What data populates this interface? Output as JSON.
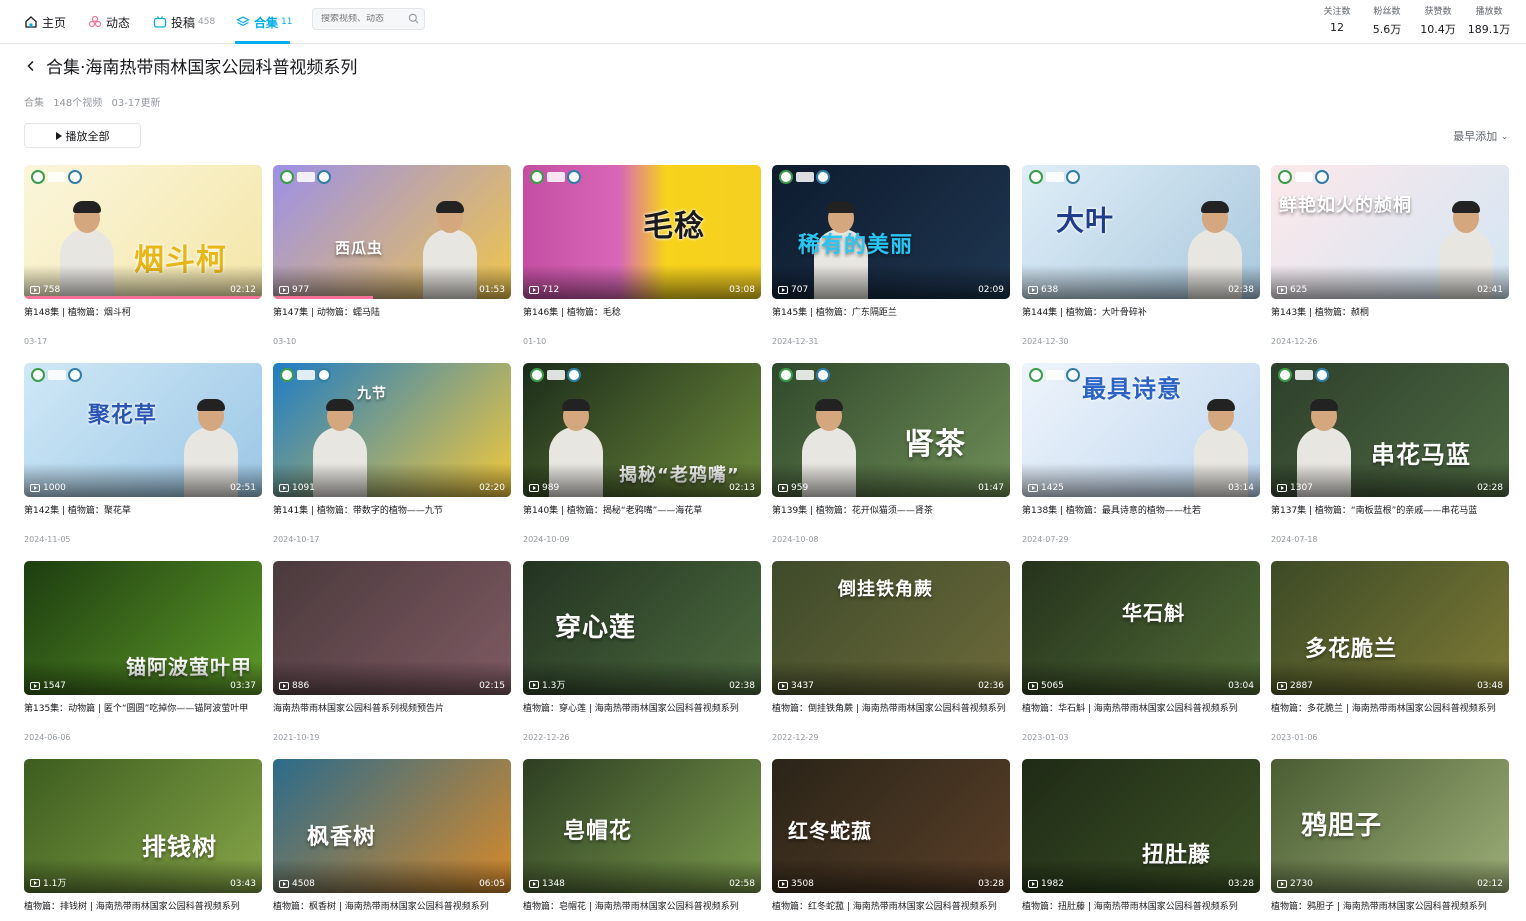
{
  "nav": {
    "home": "主页",
    "dynamic": "动态",
    "uploads": "投稿",
    "uploads_count": "458",
    "collections": "合集",
    "collections_count": "11",
    "search_placeholder": "搜索视频、动态"
  },
  "stats": [
    {
      "label": "关注数",
      "value": "12"
    },
    {
      "label": "粉丝数",
      "value": "5.6万"
    },
    {
      "label": "获赞数",
      "value": "10.4万"
    },
    {
      "label": "播放数",
      "value": "189.1万"
    }
  ],
  "collection": {
    "title": "合集·海南热带雨林国家公园科普视频系列",
    "type": "合集",
    "video_count": "148个视频",
    "updated": "03-17更新",
    "play_all": "播放全部",
    "sort": "最早添加"
  },
  "colors": {
    "accent": "#00aeec",
    "progress": "#fb7299"
  },
  "videos": [
    {
      "views": "758",
      "duration": "02:12",
      "title": "第148集 | 植物篇：烟斗柯",
      "date": "03-17",
      "overlay": "烟斗柯",
      "bg": "linear-gradient(135deg,#fbf6dc,#f4e6a8)",
      "ink": "#e8b617",
      "person": true,
      "watched": 1
    },
    {
      "views": "977",
      "duration": "01:53",
      "title": "第147集 | 动物篇：蠕马陆",
      "date": "03-10",
      "overlay": "西瓜虫",
      "bg": "linear-gradient(135deg,#9b8fe8,#f0c64a)",
      "ink": "#ffffff",
      "person": true,
      "watched": 0.42
    },
    {
      "views": "712",
      "duration": "03:08",
      "title": "第146集 | 植物篇：毛稔",
      "date": "01-10",
      "overlay": "毛稔",
      "bg": "linear-gradient(90deg,#c44fa2 0%,#d866b7 40%,#f7d31c 60%,#f5cf20 100%)",
      "ink": "#1a1a1a",
      "person": false,
      "watched": 0
    },
    {
      "views": "707",
      "duration": "02:09",
      "title": "第145集 | 植物篇：广东隔距兰",
      "date": "2024-12-31",
      "overlay": "稀有的美丽",
      "bg": "linear-gradient(135deg,#0d1b2e,#1f3650)",
      "ink": "#29c6f4",
      "person": true,
      "watched": 0
    },
    {
      "views": "638",
      "duration": "02:38",
      "title": "第144集 | 植物篇：大叶骨碎补",
      "date": "2024-12-30",
      "overlay": "大叶",
      "bg": "linear-gradient(135deg,#dfeef8,#a9c8dd)",
      "ink": "#1f3d8a",
      "person": true,
      "watched": 0
    },
    {
      "views": "625",
      "duration": "02:41",
      "title": "第143集 | 植物篇：赪桐",
      "date": "2024-12-26",
      "overlay": "鲜艳如火的赪桐",
      "bg": "linear-gradient(135deg,#fde8ea,#d2e6f4)",
      "ink": "#ffffff",
      "person": true,
      "watched": 0
    },
    {
      "views": "1000",
      "duration": "02:51",
      "title": "第142集 | 植物篇：聚花草",
      "date": "2024-11-05",
      "overlay": "聚花草",
      "bg": "linear-gradient(135deg,#cfe8f6,#9cc7e6)",
      "ink": "#2a55b3",
      "person": true,
      "watched": 0
    },
    {
      "views": "1091",
      "duration": "02:20",
      "title": "第141集 | 植物篇：带数字的植物——九节",
      "date": "2024-10-17",
      "overlay": "九节",
      "bg": "linear-gradient(135deg,#1d7cc6,#f3c83b)",
      "ink": "#ffffff",
      "person": true,
      "watched": 0
    },
    {
      "views": "989",
      "duration": "02:13",
      "title": "第140集 | 植物篇：揭秘“老鸦嘴”——海花草",
      "date": "2024-10-09",
      "overlay": "揭秘“老鸦嘴”",
      "bg": "linear-gradient(135deg,#1b2c1a,#6d8a3b)",
      "ink": "#ffffff",
      "person": true,
      "watched": 0
    },
    {
      "views": "959",
      "duration": "01:47",
      "title": "第139集 | 植物篇：花开似猫须——肾茶",
      "date": "2024-10-08",
      "overlay": "肾茶",
      "bg": "linear-gradient(135deg,#30482b,#6f8f58)",
      "ink": "#ffffff",
      "person": true,
      "watched": 0
    },
    {
      "views": "1425",
      "duration": "03:14",
      "title": "第138集 | 植物篇：最具诗意的植物——杜若",
      "date": "2024-07-29",
      "overlay": "最具诗意",
      "bg": "linear-gradient(135deg,#eef4fb,#bfd7ef)",
      "ink": "#2b63c6",
      "person": true,
      "watched": 0
    },
    {
      "views": "1307",
      "duration": "02:28",
      "title": "第137集 | 植物篇：“南板蓝根”的亲戚——串花马蓝",
      "date": "2024-07-18",
      "overlay": "串花马蓝",
      "bg": "linear-gradient(135deg,#2d3f2b,#4f6b43)",
      "ink": "#ffffff",
      "person": true,
      "watched": 0
    },
    {
      "views": "1547",
      "duration": "03:37",
      "title": "第135集：动物篇 | 匿个“圆圆”吃掉你——锚阿波萤叶甲",
      "date": "2024-06-06",
      "overlay": "锚阿波萤叶甲",
      "bg": "linear-gradient(135deg,#1d3d10,#5d9a28)",
      "ink": "#ffffff",
      "person": false,
      "watched": 0
    },
    {
      "views": "886",
      "duration": "02:15",
      "title": "海南热带雨林国家公园科普系列视频预告片",
      "date": "2021-10-19",
      "overlay": "",
      "bg": "linear-gradient(135deg,#4a3a3c,#7f5a63)",
      "ink": "#ffffff",
      "person": false,
      "watched": 0
    },
    {
      "views": "1.3万",
      "duration": "02:38",
      "title": "植物篇：穿心莲 | 海南热带雨林国家公园科普视频系列",
      "date": "2022-12-26",
      "overlay": "穿心莲",
      "bg": "linear-gradient(135deg,#233321,#4d6b3f)",
      "ink": "#ffffff",
      "person": false,
      "watched": 0
    },
    {
      "views": "3437",
      "duration": "02:36",
      "title": "植物篇：倒挂铁角蕨 | 海南热带雨林国家公园科普视频系列",
      "date": "2022-12-29",
      "overlay": "倒挂铁角蕨",
      "bg": "linear-gradient(135deg,#3e4a2a,#6c6a3a)",
      "ink": "#ffffff",
      "person": false,
      "watched": 0
    },
    {
      "views": "5065",
      "duration": "03:04",
      "title": "植物篇：华石斛 | 海南热带雨林国家公园科普视频系列",
      "date": "2023-01-03",
      "overlay": "华石斛",
      "bg": "linear-gradient(135deg,#25331c,#506a36)",
      "ink": "#ffffff",
      "person": false,
      "watched": 0
    },
    {
      "views": "2887",
      "duration": "03:48",
      "title": "植物篇：多花脆兰 | 海南热带雨林国家公园科普视频系列",
      "date": "2023-01-06",
      "overlay": "多花脆兰",
      "bg": "linear-gradient(135deg,#3c4a26,#7d7a35)",
      "ink": "#ffffff",
      "person": false,
      "watched": 0
    },
    {
      "views": "1.1万",
      "duration": "03:43",
      "title": "植物篇：排钱树 | 海南热带雨林国家公园科普视频系列",
      "date": "",
      "overlay": "排钱树",
      "bg": "linear-gradient(135deg,#3c5d1f,#86a548)",
      "ink": "#ffffff",
      "person": false,
      "watched": 0
    },
    {
      "views": "4508",
      "duration": "06:05",
      "title": "植物篇：枫香树 | 海南热带雨林国家公园科普视频系列",
      "date": "",
      "overlay": "枫香树",
      "bg": "linear-gradient(135deg,#2b6b8c,#d88a2a)",
      "ink": "#ffffff",
      "person": false,
      "watched": 0
    },
    {
      "views": "1348",
      "duration": "02:58",
      "title": "植物篇：皂帽花 | 海南热带雨林国家公园科普视频系列",
      "date": "",
      "overlay": "皂帽花",
      "bg": "linear-gradient(135deg,#2d3e22,#7a9a4c)",
      "ink": "#ffffff",
      "person": false,
      "watched": 0
    },
    {
      "views": "3508",
      "duration": "03:28",
      "title": "植物篇：红冬蛇菰 | 海南热带雨林国家公园科普视频系列",
      "date": "",
      "overlay": "红冬蛇菰",
      "bg": "linear-gradient(135deg,#2a2418,#5a3f28)",
      "ink": "#ffffff",
      "person": false,
      "watched": 0
    },
    {
      "views": "1982",
      "duration": "03:28",
      "title": "植物篇：扭肚藤 | 海南热带雨林国家公园科普视频系列",
      "date": "",
      "overlay": "扭肚藤",
      "bg": "linear-gradient(135deg,#1f2b16,#3c5226)",
      "ink": "#ffffff",
      "person": false,
      "watched": 0
    },
    {
      "views": "2730",
      "duration": "02:12",
      "title": "植物篇：鸦胆子 | 海南热带雨林国家公园科普视频系列",
      "date": "",
      "overlay": "鸦胆子",
      "bg": "linear-gradient(135deg,#4a5d33,#9cae77)",
      "ink": "#ffffff",
      "person": false,
      "watched": 0
    }
  ]
}
